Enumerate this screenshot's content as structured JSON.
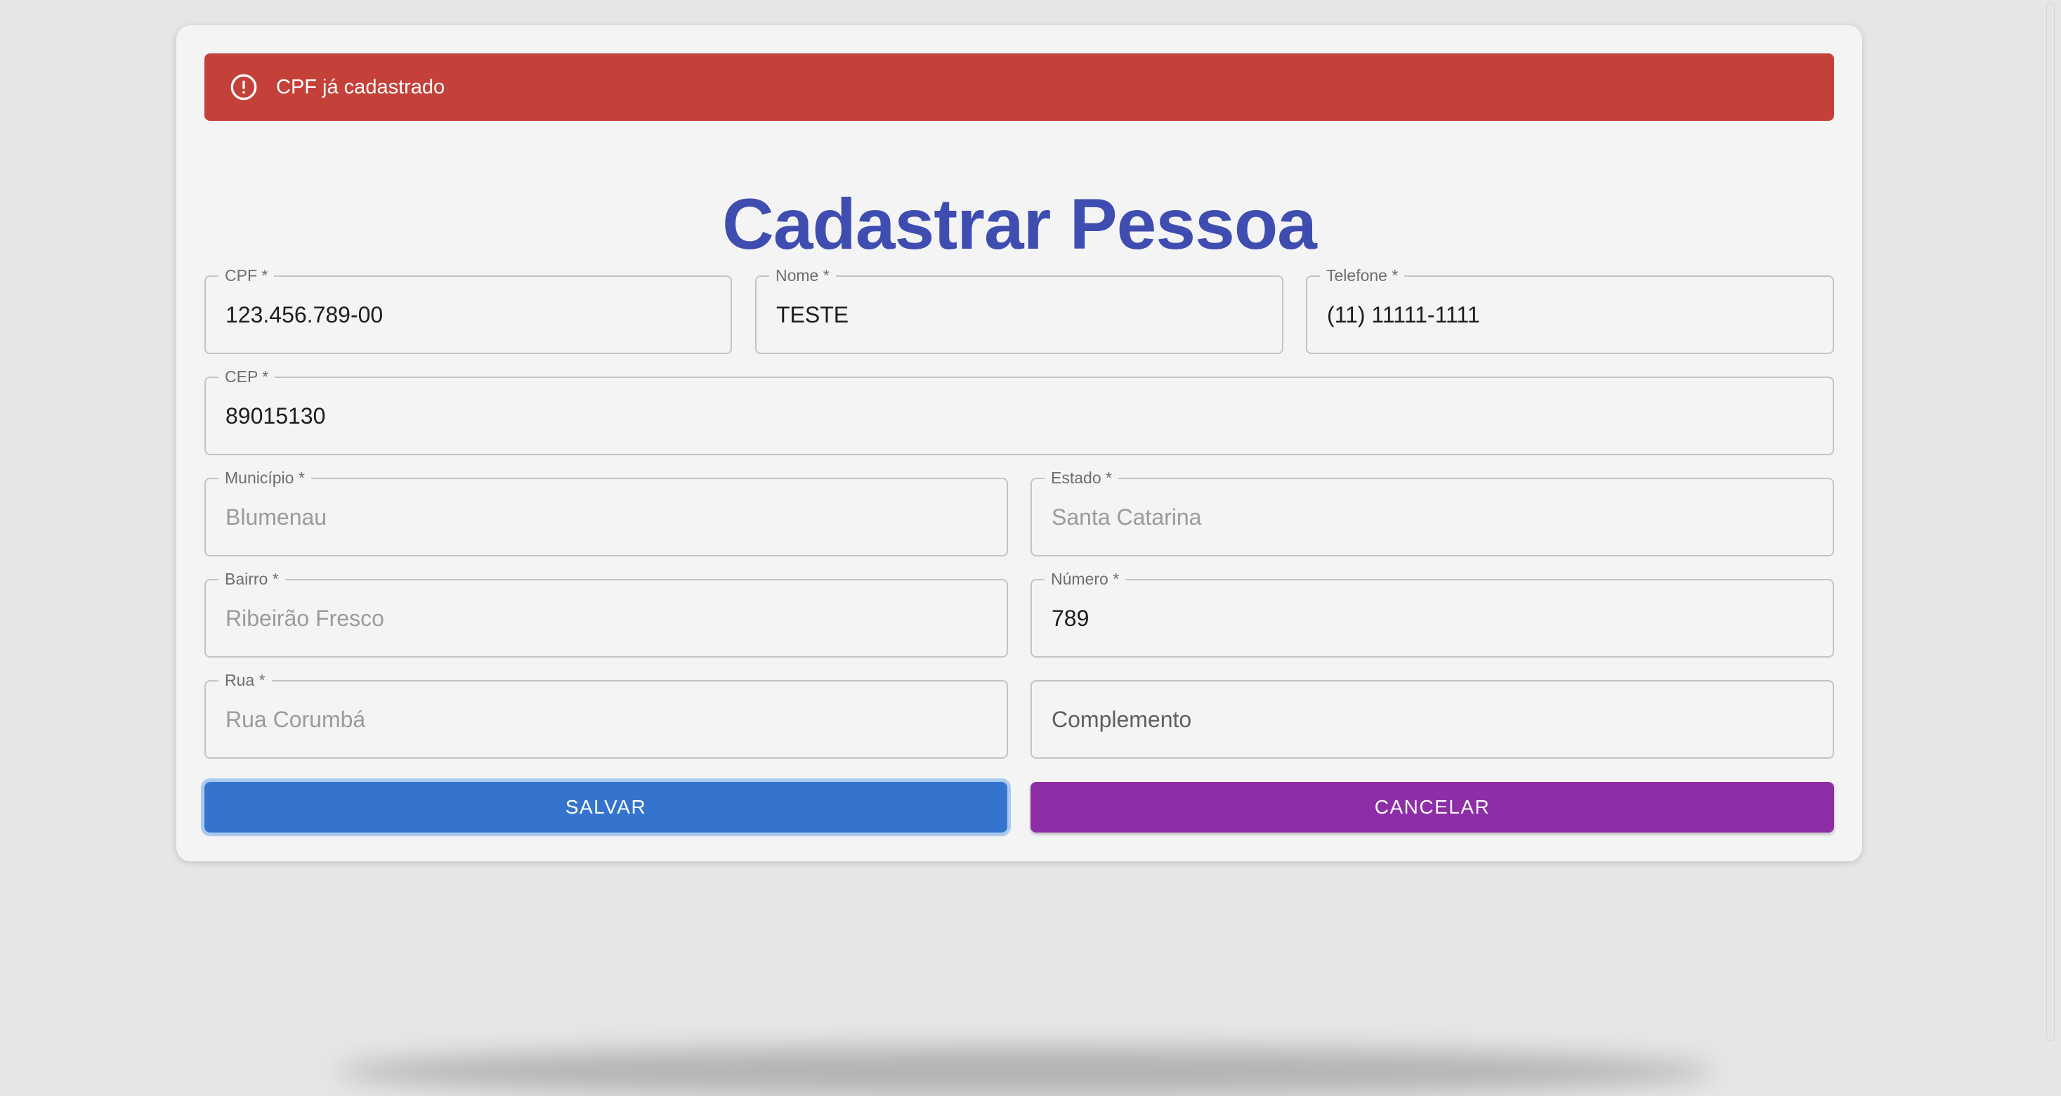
{
  "alert": {
    "message": "CPF já cadastrado",
    "icon": "error-outline-icon",
    "color": "#c4413a"
  },
  "form": {
    "title": "Cadastrar Pessoa",
    "fields": {
      "cpf": {
        "label": "CPF *",
        "value": "123.456.789-00"
      },
      "nome": {
        "label": "Nome *",
        "value": "TESTE"
      },
      "telefone": {
        "label": "Telefone *",
        "value": "(11) 11111-1111"
      },
      "cep": {
        "label": "CEP *",
        "value": "89015130"
      },
      "municipio": {
        "label": "Município *",
        "value": "Blumenau"
      },
      "estado": {
        "label": "Estado *",
        "value": "Santa Catarina"
      },
      "bairro": {
        "label": "Bairro *",
        "value": "Ribeirão Fresco"
      },
      "numero": {
        "label": "Número *",
        "value": "789"
      },
      "rua": {
        "label": "Rua *",
        "value": "Rua Corumbá"
      },
      "complemento": {
        "placeholder": "Complemento"
      }
    }
  },
  "buttons": {
    "save": "SALVAR",
    "cancel": "CANCELAR"
  },
  "colors": {
    "title": "#3f4db0",
    "save_button": "#3574cc",
    "cancel_button": "#8d2ea6",
    "background": "#e6e6e6"
  }
}
